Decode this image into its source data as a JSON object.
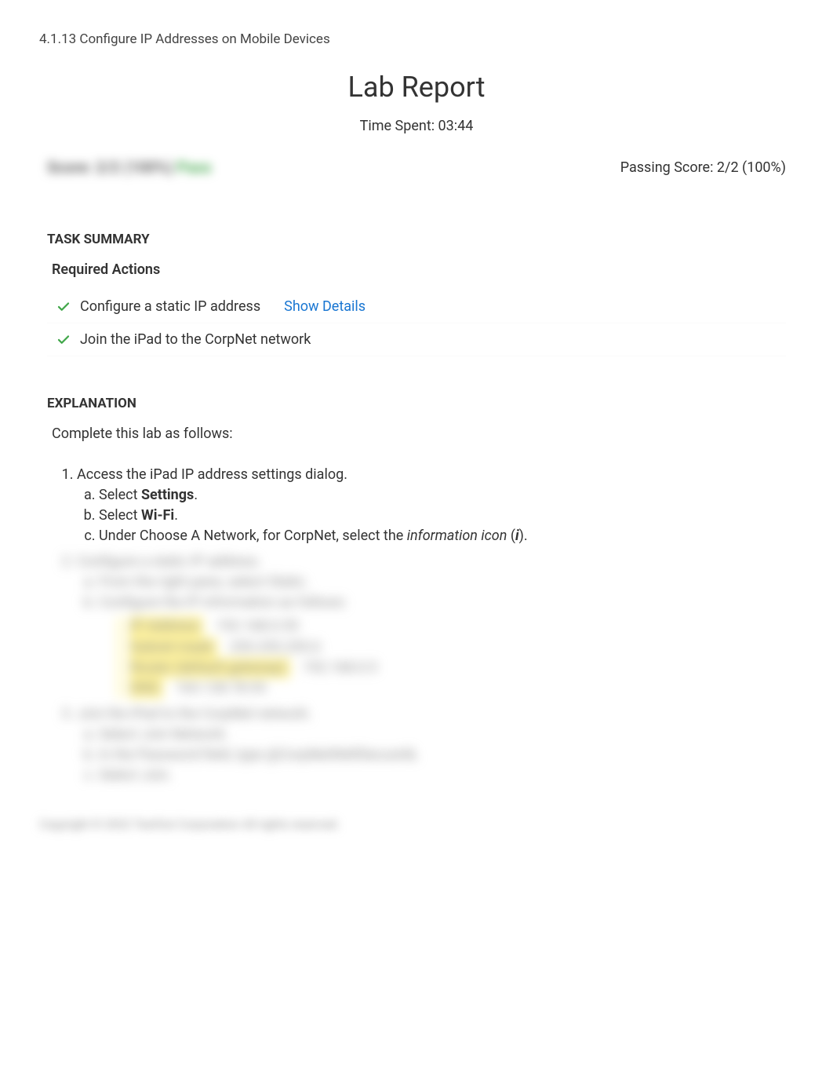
{
  "breadcrumb": "4.1.13 Configure IP Addresses on Mobile Devices",
  "reportTitle": "Lab Report",
  "timeSpent": "Time Spent: 03:44",
  "scoreBlurred": {
    "label": "Score: 2/2 (100%) ",
    "status": "Pass"
  },
  "passingScore": "Passing Score: 2/2 (100%)",
  "taskSummaryHeading": "TASK SUMMARY",
  "requiredActionsHeading": "Required Actions",
  "actions": [
    {
      "label": "Configure a static IP address",
      "showDetails": "Show Details"
    },
    {
      "label": "Join the iPad to the CorpNet network"
    }
  ],
  "explanationHeading": "EXPLANATION",
  "explanationIntro": "Complete this lab as follows:",
  "step1": {
    "title": "Access the iPad IP address settings dialog.",
    "a_pre": "Select ",
    "a_bold": "Settings",
    "a_post": ".",
    "b_pre": "Select ",
    "b_bold": "Wi-Fi",
    "b_post": ".",
    "c_pre": "Under Choose A Network, for CorpNet, select the ",
    "c_italic": "information icon",
    "c_paren_open": " (",
    "c_i": "i",
    "c_paren_close": ")."
  },
  "blurredSteps": {
    "step2": {
      "title": "Configure a static IP address.",
      "a": "From the right pane, select Static.",
      "b": "Configure the IP information as follows:",
      "rows": [
        {
          "k": "IP Address:",
          "v": "192.168.0.55"
        },
        {
          "k": "Subnet mask:",
          "v": "255.255.255.0"
        },
        {
          "k": "Router (default gateway):",
          "v": "192.168.0.5"
        },
        {
          "k": "DNS:",
          "v": "163.128.78.93"
        }
      ]
    },
    "step3": {
      "title": "Join the iPad to the CorpNet network.",
      "a": "Select Join Network.",
      "b": "In the Password field, type @CorpNetWeRSecure!&.",
      "c": "Select Join."
    }
  },
  "copyright": "Copyright © 2022 TestOut Corporation All rights reserved."
}
